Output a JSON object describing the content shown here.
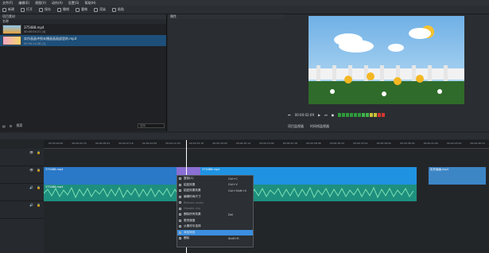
{
  "menubar": [
    "文件(F)",
    "编辑(E)",
    "视图(V)",
    "动作(A)",
    "设置(S)",
    "帮助(H)"
  ],
  "toolbar": {
    "new_label": "新建",
    "open_label": "打开",
    "save_label": "保存",
    "undo_label": "撤销",
    "redo_label": "重做",
    "render_label": "渲染",
    "paste_label": "粘贴"
  },
  "bin": {
    "header": "项目素材",
    "folder": "名称",
    "items": [
      {
        "name": "375488.mp4",
        "meta": "00:00:04:21 [4]"
      },
      {
        "name": "实作画画冲到末播画画画部里的.mp4",
        "meta": "00:00:14:28 [1]"
      }
    ],
    "footer_left": "搜索",
    "search_placeholder": "搜索"
  },
  "properties": {
    "header": "属性"
  },
  "monitor": {
    "timecode": "00:00:02:09",
    "tabs": [
      "项目监视器",
      "时间线监视器"
    ]
  },
  "ruler": {
    "ticks": [
      "00:00:00:00",
      "00:00:02:15",
      "00:00:05:02",
      "00:00:07:16",
      "00:00:10:06",
      "00:00:12:20",
      "00:00:15:10",
      "00:00:18:00",
      "00:00:20:14",
      "00:00:23:04",
      "00:00:25:18",
      "00:00:28:08",
      "00:00:30:22",
      "00:00:33:12",
      "00:00:36:02",
      "00:00:38:16",
      "00:00:41:06",
      "00:00:43:20",
      "00:00:46:10"
    ]
  },
  "tracks": {
    "video_clip_1": "375488.mp4",
    "video_clip_2": "375488.mp4",
    "video_clip_3": "实作画画.mp4",
    "audio_clip": "375488.mp4"
  },
  "context_menu": {
    "items": [
      {
        "label": "复制(C)",
        "shortcut": "Ctrl+C"
      },
      {
        "label": "粘贴效果",
        "shortcut": "Ctrl+V"
      },
      {
        "label": "粘贴效果效果",
        "shortcut": "Ctrl+Shift+V"
      },
      {
        "label": "编辑时间尺寸",
        "shortcut": ""
      },
      {
        "label": "Restore audio",
        "shortcut": ""
      },
      {
        "label": "Disable clip",
        "shortcut": ""
      },
      {
        "label": "删除所有效果",
        "shortcut": "Del"
      },
      {
        "label": "更改速度",
        "shortcut": ""
      },
      {
        "label": "从素材中选择",
        "shortcut": ""
      },
      {
        "label": "添加特效",
        "shortcut": ""
      },
      {
        "label": "删除",
        "shortcut": "Shift+R"
      }
    ],
    "highlighted_index": 9
  },
  "colors": {
    "accent": "#3b8ee0",
    "video_clip": "#2a78c8",
    "audio_clip": "#1e8f7e",
    "selected_clip": "#8a6fd4"
  }
}
